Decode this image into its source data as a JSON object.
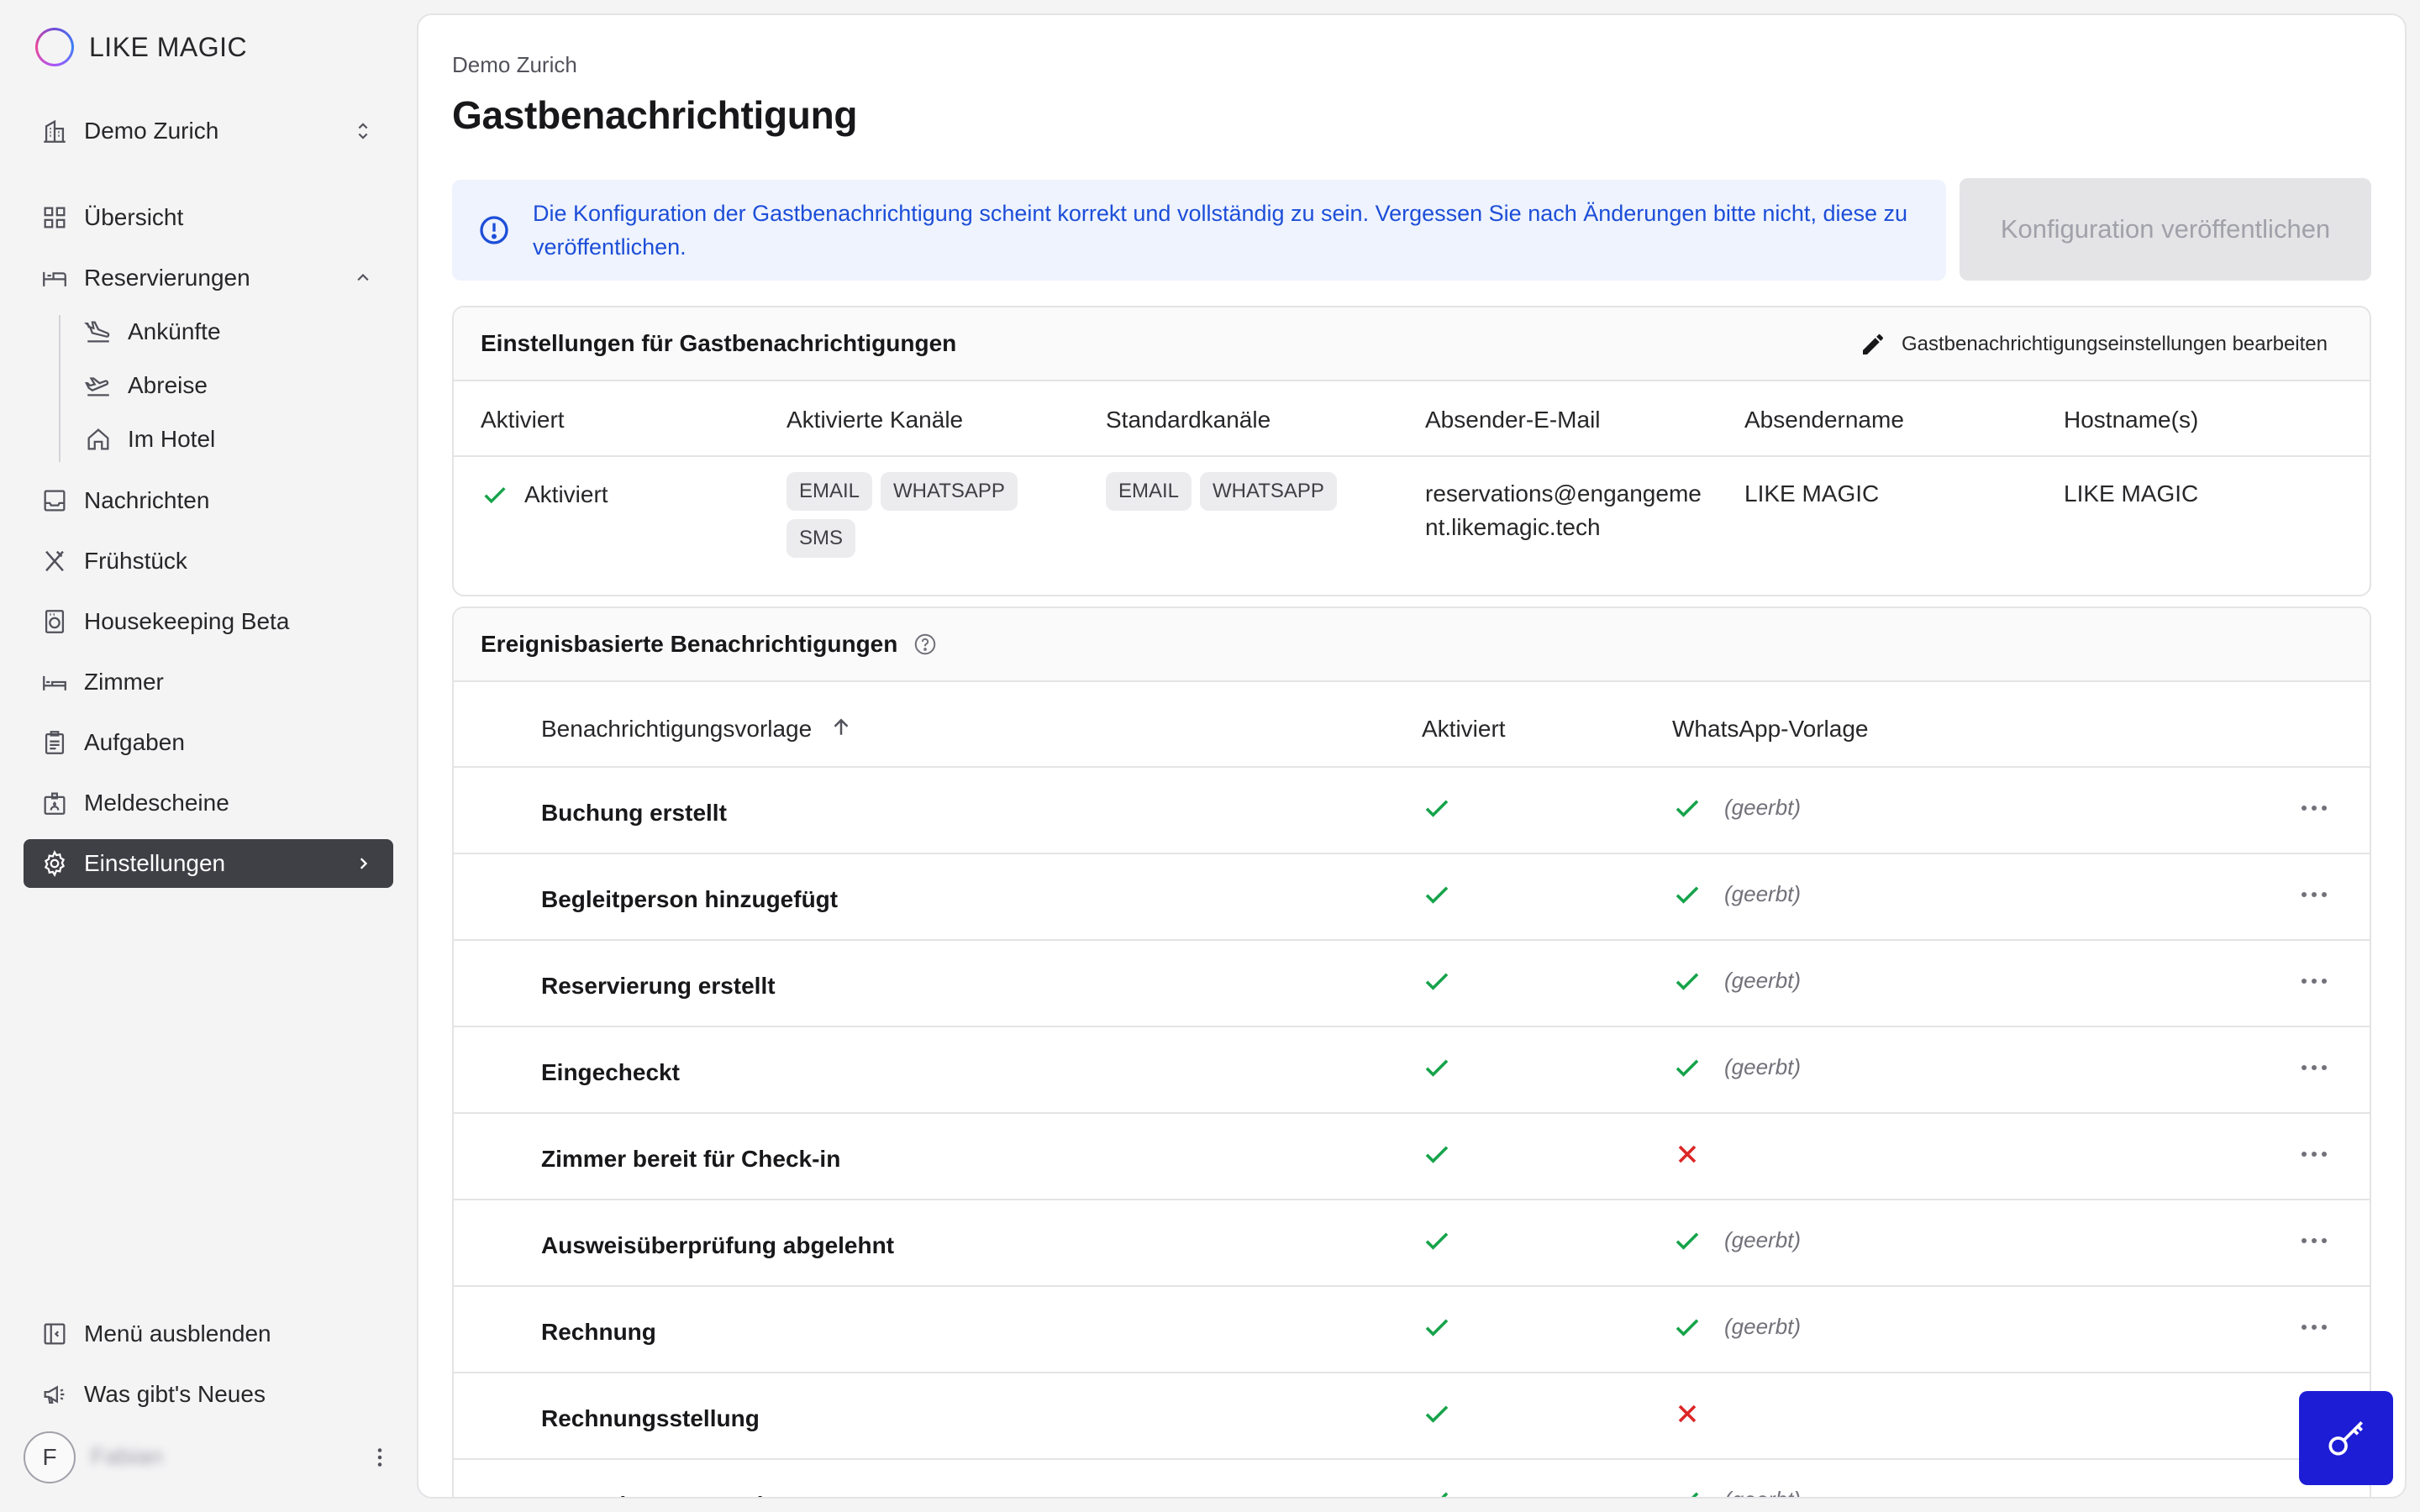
{
  "brand": {
    "name": "LIKE MAGIC"
  },
  "sidebar": {
    "property": "Demo Zurich",
    "items": [
      {
        "label": "Übersicht",
        "icon": "grid-icon"
      },
      {
        "label": "Reservierungen",
        "icon": "bed-icon"
      },
      {
        "label": "Ankünfte",
        "icon": "plane-landing-icon"
      },
      {
        "label": "Abreise",
        "icon": "plane-takeoff-icon"
      },
      {
        "label": "Im Hotel",
        "icon": "home-icon"
      },
      {
        "label": "Nachrichten",
        "icon": "inbox-icon"
      },
      {
        "label": "Frühstück",
        "icon": "utensils-icon"
      },
      {
        "label": "Housekeeping Beta",
        "icon": "washing-machine-icon"
      },
      {
        "label": "Zimmer",
        "icon": "bed-icon"
      },
      {
        "label": "Aufgaben",
        "icon": "clipboard-icon"
      },
      {
        "label": "Meldescheine",
        "icon": "id-card-icon"
      },
      {
        "label": "Einstellungen",
        "icon": "gear-icon"
      }
    ],
    "hide_menu": "Menü ausblenden",
    "whats_new": "Was gibt's Neues",
    "user_initial": "F",
    "user_name": "Fabian"
  },
  "page": {
    "breadcrumb": "Demo Zurich",
    "title": "Gastbenachrichtigung",
    "alert": "Die Konfiguration der Gastbenachrichtigung scheint korrekt und vollständig zu sein. Vergessen Sie nach Änderungen bitte nicht, diese zu veröffentlichen.",
    "publish_button": "Konfiguration veröffentlichen"
  },
  "settings_card": {
    "title": "Einstellungen für Gastbenachrichtigungen",
    "edit_label": "Gastbenachrichtigungseinstellungen bearbeiten",
    "columns": [
      "Aktiviert",
      "Aktivierte Kanäle",
      "Standardkanäle",
      "Absender-E-Mail",
      "Absendername",
      "Hostname(s)"
    ],
    "row": {
      "activated": "Aktiviert",
      "enabled_channels": [
        "EMAIL",
        "WHATSAPP",
        "SMS"
      ],
      "default_channels": [
        "EMAIL",
        "WHATSAPP"
      ],
      "sender_email_line1": "reservations@engangeme",
      "sender_email_line2": "nt.likemagic.tech",
      "sender_name": "LIKE MAGIC",
      "hostname": "LIKE MAGIC"
    }
  },
  "events_card": {
    "title": "Ereignisbasierte Benachrichtigungen",
    "columns": {
      "template": "Benachrichtigungsvorlage",
      "activated": "Aktiviert",
      "whatsapp": "WhatsApp-Vorlage"
    },
    "rows": [
      {
        "name": "Buchung erstellt",
        "active": true,
        "whatsapp": true,
        "note": "(geerbt)"
      },
      {
        "name": "Begleitperson hinzugefügt",
        "active": true,
        "whatsapp": true,
        "note": "(geerbt)"
      },
      {
        "name": "Reservierung erstellt",
        "active": true,
        "whatsapp": true,
        "note": "(geerbt)"
      },
      {
        "name": "Eingecheckt",
        "active": true,
        "whatsapp": true,
        "note": "(geerbt)"
      },
      {
        "name": "Zimmer bereit für Check-in",
        "active": true,
        "whatsapp": false,
        "note": ""
      },
      {
        "name": "Ausweisüberprüfung abgelehnt",
        "active": true,
        "whatsapp": true,
        "note": "(geerbt)"
      },
      {
        "name": "Rechnung",
        "active": true,
        "whatsapp": true,
        "note": "(geerbt)"
      },
      {
        "name": "Rechnungsstellung",
        "active": true,
        "whatsapp": false,
        "note": ""
      },
      {
        "name": "Reservierung storniert",
        "active": true,
        "whatsapp": true,
        "note": "(geerbt)"
      }
    ]
  },
  "colors": {
    "accent_active": "#3f3f46",
    "success": "#16a34a",
    "error": "#dc2626",
    "info": "#1d4ed8",
    "fab": "#1d1dd6"
  }
}
